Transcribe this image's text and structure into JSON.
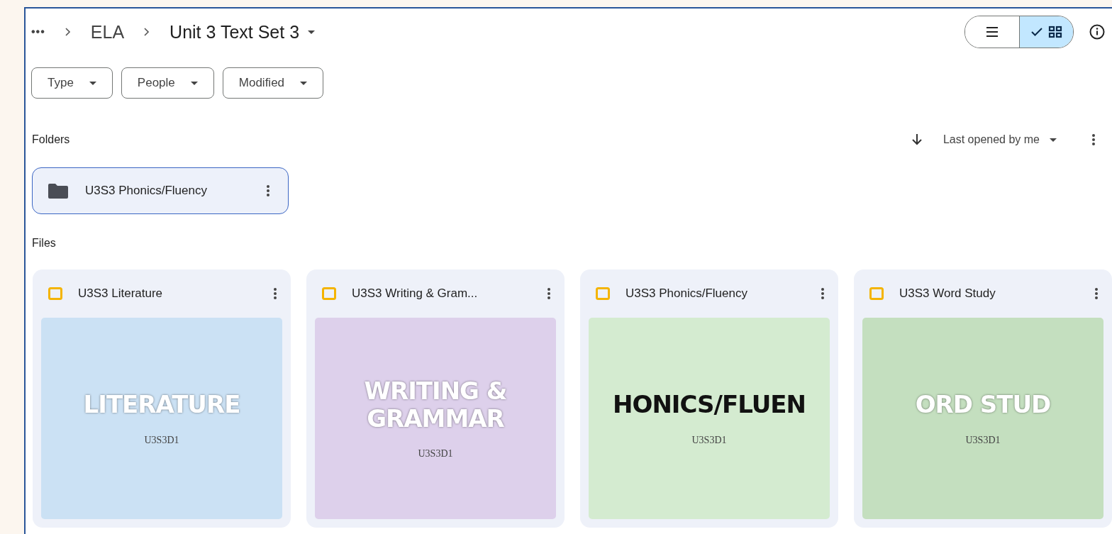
{
  "breadcrumbs": {
    "overflow": "•••",
    "items": [
      {
        "label": "ELA",
        "current": false
      },
      {
        "label": "Unit 3 Text Set 3",
        "current": true
      }
    ]
  },
  "view_toggle": [
    {
      "kind": "list",
      "selected": false
    },
    {
      "kind": "grid",
      "selected": true
    }
  ],
  "filters": [
    {
      "label": "Type"
    },
    {
      "label": "People"
    },
    {
      "label": "Modified"
    }
  ],
  "folders": {
    "heading": "Folders",
    "sort": {
      "label": "Last opened by me"
    },
    "items": [
      {
        "name": "U3S3 Phonics/Fluency",
        "selected": true
      }
    ]
  },
  "files": {
    "heading": "Files",
    "items": [
      {
        "name": "U3S3 Literature",
        "thumbnail": {
          "color": "#cbe1f4",
          "title": [
            {
              "text": "LITERATURE",
              "color": "#ffffff"
            }
          ],
          "code": "U3S3D1"
        }
      },
      {
        "name": "U3S3 Writing & Gram...",
        "thumbnail": {
          "color": "#ddd0eb",
          "title": [
            {
              "text": "WRITING &",
              "color": "#ffffff"
            },
            {
              "text": "GRAMMAR",
              "color": "#ffffff"
            }
          ],
          "code": "U3S3D1"
        }
      },
      {
        "name": "U3S3 Phonics/Fluency",
        "thumbnail": {
          "color": "#d4ebd0",
          "title": [
            {
              "text": "HONICS/FLUEN",
              "color": "#111111"
            }
          ],
          "code": "U3S3D1"
        }
      },
      {
        "name": "U3S3 Word Study",
        "thumbnail": {
          "color": "#c4dfbf",
          "title": [
            {
              "text": "ORD STUD",
              "color": "#ffffff"
            }
          ],
          "code": "U3S3D1"
        }
      }
    ]
  }
}
